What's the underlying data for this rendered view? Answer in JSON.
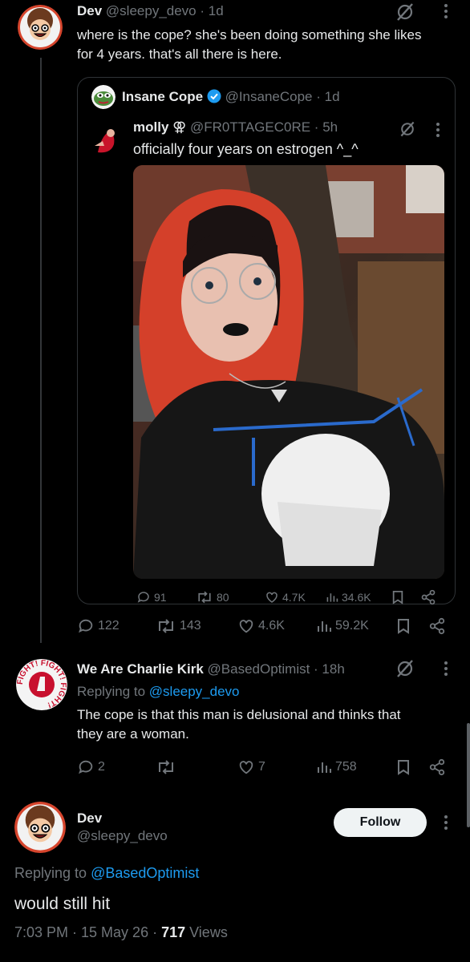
{
  "post1": {
    "name": "Dev",
    "handle": "@sleepy_devo · 1d",
    "text_line1": "where is the cope? she's been doing something she likes",
    "text_line2": "for 4 years. that's all there is here."
  },
  "quote": {
    "name": "Insane Cope",
    "handle": "@InsaneCope · 1d",
    "nested": {
      "name": "molly",
      "pronoun_symbol": "⚢",
      "handle": "@FR0TTAGEC0RE · 5h",
      "text": "officially four years on estrogen ^_^"
    },
    "stats": {
      "replies": "91",
      "reposts": "80",
      "likes": "4.7K",
      "views": "34.6K"
    }
  },
  "post1_stats": {
    "replies": "122",
    "reposts": "143",
    "likes": "4.6K",
    "views": "59.2K"
  },
  "post2": {
    "name": "We Are Charlie Kirk",
    "handle": "@BasedOptimist · 18h",
    "replying_prefix": "Replying to ",
    "replying_handle": "@sleepy_devo",
    "text_line1": "The cope is that this man is delusional and thinks that",
    "text_line2": "they are a woman.",
    "avatar_text": "FIGHT! FIGHT! FIGHT!",
    "stats": {
      "replies": "2",
      "reposts": "",
      "likes": "7",
      "views": "758"
    }
  },
  "post3": {
    "name": "Dev",
    "handle": "@sleepy_devo",
    "follow_label": "Follow",
    "replying_prefix": "Replying to ",
    "replying_handle": "@BasedOptimist",
    "text": "would still hit",
    "time": "7:03 PM · 15 May 26 · ",
    "views_count": "717",
    "views_label": " Views"
  },
  "colors": {
    "background": "#000000",
    "text": "#e7e9ea",
    "muted": "#71767b",
    "link": "#1d9bf0",
    "border": "#2f3336"
  },
  "icons": [
    "grok-icon",
    "more-icon",
    "reply-icon",
    "repost-icon",
    "like-icon",
    "views-icon",
    "bookmark-icon",
    "share-icon",
    "verified-icon"
  ]
}
